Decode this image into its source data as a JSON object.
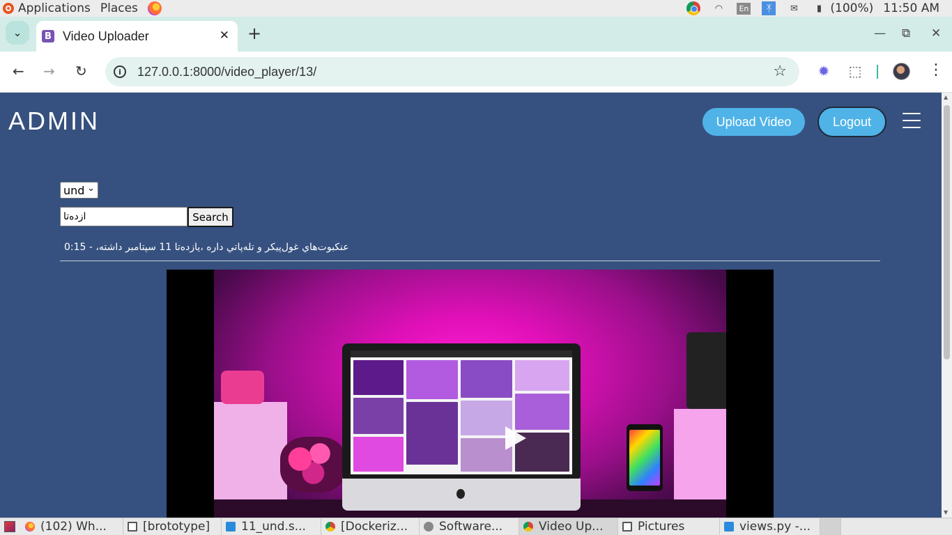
{
  "os_panel": {
    "menus": [
      "Applications",
      "Places"
    ],
    "battery": "(100%)",
    "time": "11:50 AM",
    "keyboard_layout": "En",
    "tray_icons": [
      "chrome-icon",
      "wifi-icon",
      "keyboard-layout-icon",
      "bluetooth-icon",
      "mail-icon",
      "battery-icon"
    ]
  },
  "browser": {
    "tab_title": "Video Uploader",
    "favicon_letter": "B",
    "url": "127.0.0.1:8000/video_player/13/"
  },
  "page": {
    "brand": "ADMIN",
    "upload_button": "Upload Video",
    "logout_button": "Logout",
    "language": {
      "selected": "und"
    },
    "search": {
      "value": "ازده‌تا",
      "button": "Search"
    },
    "result": "عنکبوت‌هاي غول‌پيکر و تله‌پاتي داره ،يازده‌تا 11 سپتامبر داشته، - 0:15"
  },
  "colors": {
    "page_background": "#36517f",
    "button_accent": "#4fb3e8",
    "tab_strip": "#d3ece7",
    "omnibox": "#e4f3f0"
  },
  "taskbar": {
    "tasks": [
      {
        "label": "(102) Wh...",
        "icon": "firefox-icon"
      },
      {
        "label": "[brototype]",
        "icon": "window-icon"
      },
      {
        "label": "11_und.s...",
        "icon": "vscode-icon"
      },
      {
        "label": "[Dockeriz...",
        "icon": "chrome-icon"
      },
      {
        "label": "Software...",
        "icon": "software-icon"
      },
      {
        "label": "Video Up...",
        "icon": "chrome-icon"
      },
      {
        "label": "Pictures",
        "icon": "window-icon"
      },
      {
        "label": "views.py -...",
        "icon": "vscode-icon"
      }
    ]
  }
}
